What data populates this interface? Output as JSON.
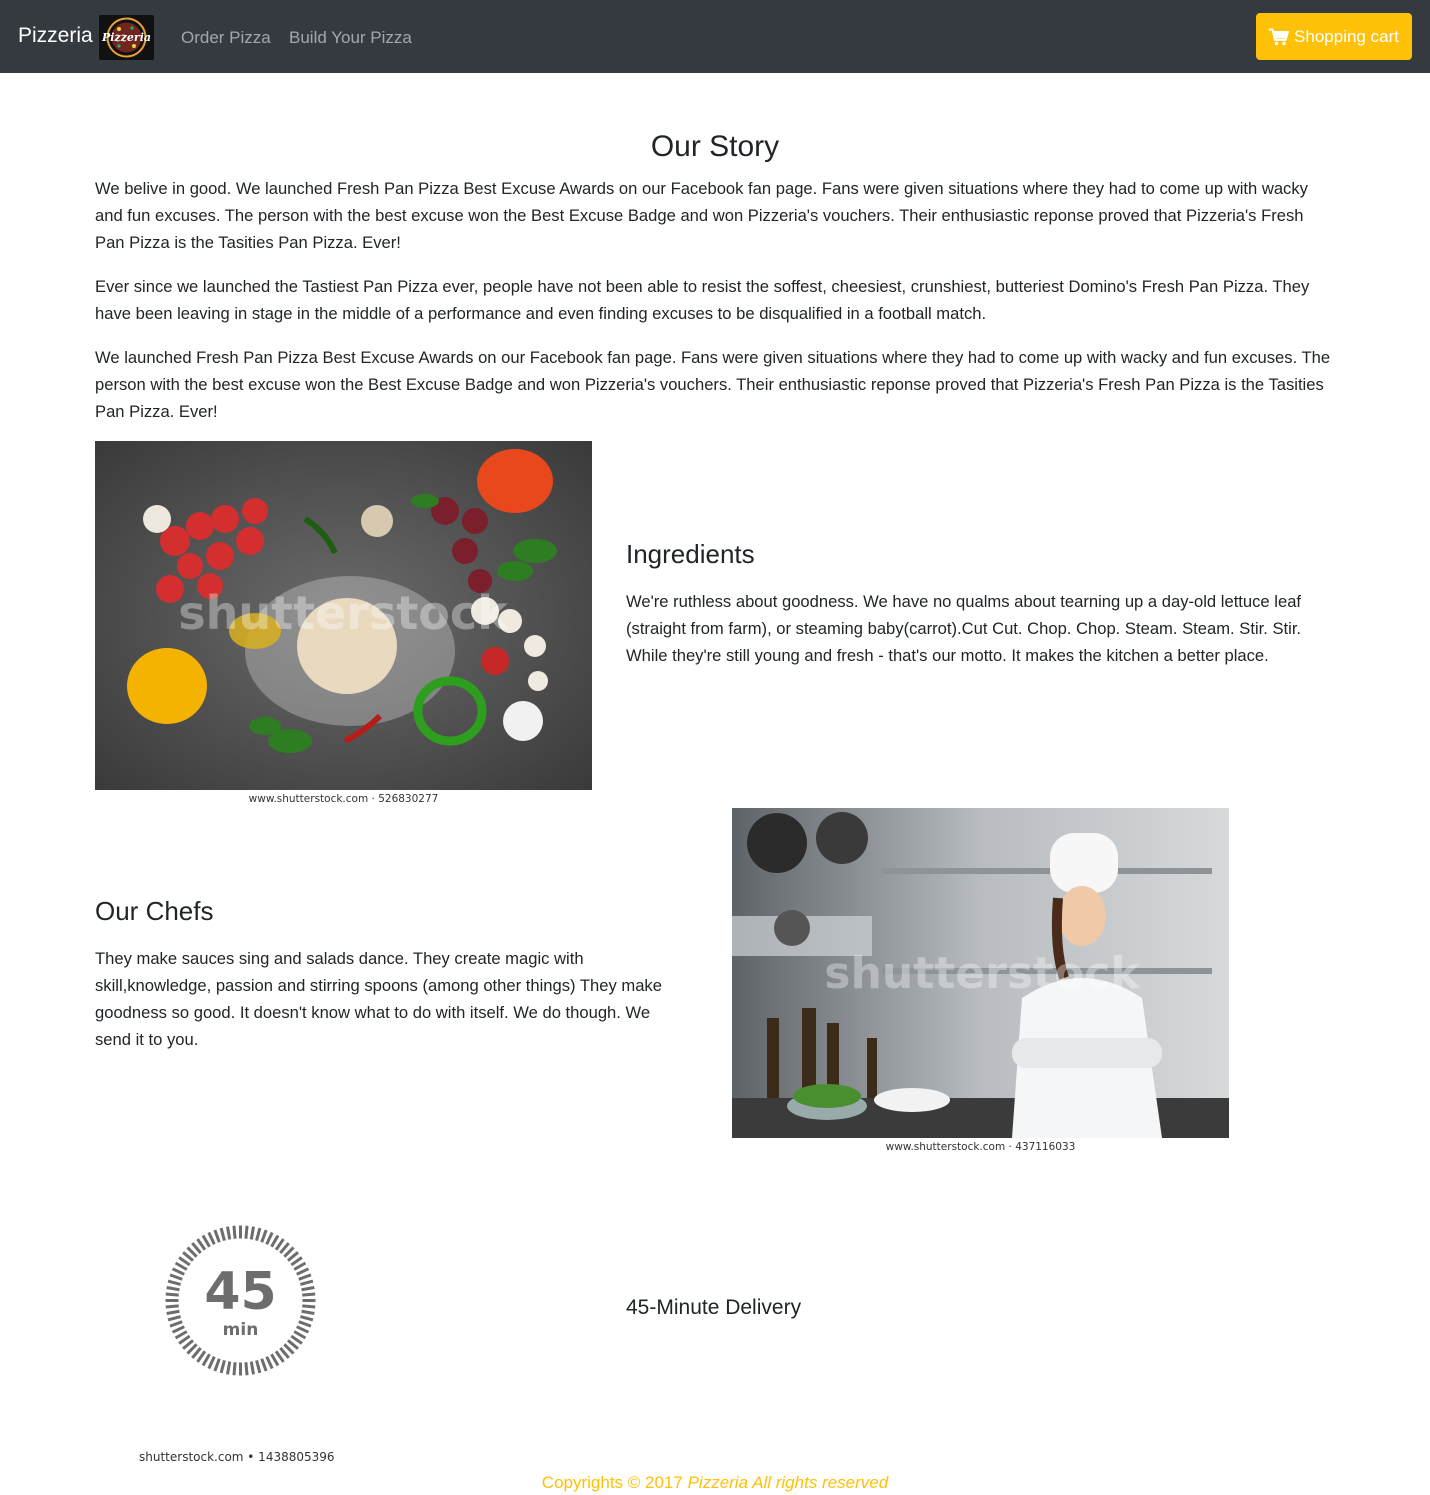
{
  "navbar": {
    "brand": "Pizzeria",
    "logo_text": "Pizzeria",
    "links": [
      "Order Pizza",
      "Build Your Pizza"
    ],
    "cart_label": "Shopping cart",
    "cart_icon": "shopping-cart-icon"
  },
  "story": {
    "title": "Our Story",
    "paragraphs": [
      "We belive in good. We launched Fresh Pan Pizza Best Excuse Awards on our Facebook fan page. Fans were given situations where they had to come up with wacky and fun excuses. The person with the best excuse won the Best Excuse Badge and won Pizzeria's vouchers. Their enthusiastic reponse proved that Pizzeria's Fresh Pan Pizza is the Tasities Pan Pizza. Ever!",
      "Ever since we launched the Tastiest Pan Pizza ever, people have not been able to resist the soffest, cheesiest, crunshiest, butteriest Domino's Fresh Pan Pizza. They have been leaving in stage in the middle of a performance and even finding excuses to be disqualified in a football match.",
      "We launched Fresh Pan Pizza Best Excuse Awards on our Facebook fan page. Fans were given situations where they had to come up with wacky and fun excuses. The person with the best excuse won the Best Excuse Badge and won Pizzeria's vouchers. Their enthusiastic reponse proved that Pizzeria's Fresh Pan Pizza is the Tasities Pan Pizza. Ever!"
    ]
  },
  "ingredients": {
    "title": "Ingredients",
    "text": "We're ruthless about goodness. We have no qualms about tearning up a day-old lettuce leaf (straight from farm), or steaming baby(carrot).Cut Cut. Chop. Chop. Steam. Steam. Stir. Stir. While they're still young and fresh - that's our motto. It makes the kitchen a better place.",
    "image_watermark": "shutterstock",
    "image_credit": "www.shutterstock.com · 526830277"
  },
  "chefs": {
    "title": "Our Chefs",
    "text": "They make sauces sing and salads dance. They create magic with skill,knowledge, passion and stirring spoons (among other things) They make goodness so good. It doesn't know what to do with itself. We do though. We send it to you.",
    "image_watermark": "shutterstock",
    "image_credit": "www.shutterstock.com · 437116033"
  },
  "delivery": {
    "title": "45-Minute Delivery",
    "timer_number": "45",
    "timer_unit": "min",
    "image_credit": "shutterstock.com • 1438805396"
  },
  "footer": {
    "prefix": "Copyrights © 2017 ",
    "suffix": "Pizzeria All rights reserved"
  },
  "colors": {
    "navbar_bg": "#343a40",
    "accent": "#ffc107",
    "text": "#212529"
  }
}
